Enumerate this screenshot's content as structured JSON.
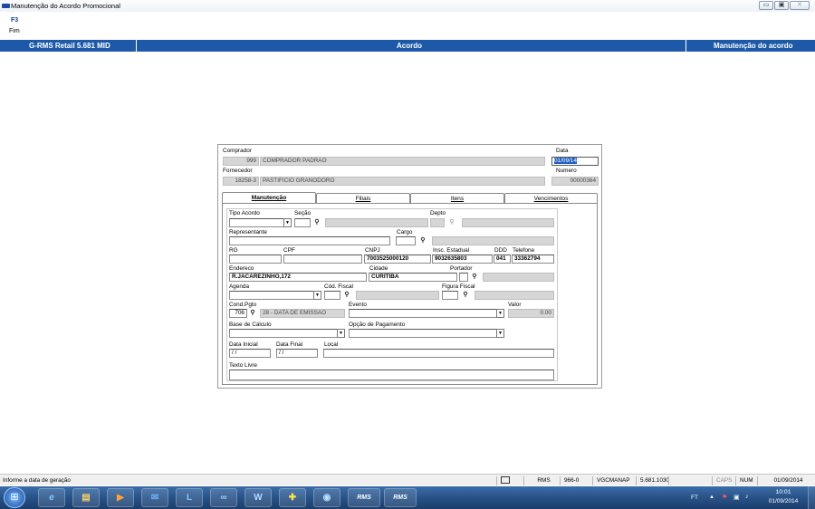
{
  "window": {
    "title": "Manutenção do Acordo Promocional",
    "min": "▭",
    "max": "▣",
    "close": "✕"
  },
  "fkey": {
    "key": "F3",
    "label": "Fim"
  },
  "header": {
    "left": "G-RMS Retail 5.681 MID",
    "center": "Acordo",
    "right": "Manutenção do acordo"
  },
  "top": {
    "comprador_label": "Comprador",
    "comprador_code": "999",
    "comprador_name": "COMPRADOR PADRAO",
    "data_label": "Data",
    "data_value": "01/09/14",
    "fornecedor_label": "Fornecedor",
    "fornecedor_code": "18258-3",
    "fornecedor_name": "PASTIFICIO GRANODORO",
    "numero_label": "Numero",
    "numero_value": "00000364"
  },
  "tabs": [
    {
      "label": "Manutenção",
      "active": true
    },
    {
      "label": "Filiais",
      "active": false
    },
    {
      "label": "Itens",
      "active": false
    },
    {
      "label": "Vencimentos",
      "active": false
    }
  ],
  "form": {
    "tipo_acordo_label": "Tipo Acordo",
    "tipo_acordo_value": "",
    "secao_label": "Seção",
    "depto_label": "Depto",
    "representante_label": "Representante",
    "cargo_label": "Cargo",
    "rg_label": "RG",
    "cpf_label": "CPF",
    "cnpj_label": "CNPJ",
    "cnpj_value": "7003525000120",
    "insc_label": "Insc. Estadual",
    "insc_value": "9032635803",
    "ddd_label": "DDD",
    "ddd_value": "041",
    "telefone_label": "Telefone",
    "telefone_value": "33362794",
    "endereco_label": "Endereco",
    "endereco_value": "R.JACAREZINHO,172",
    "cidade_label": "Cidade",
    "cidade_value": "CURITIBA",
    "portador_label": "Portador",
    "agenda_label": "Agenda",
    "cod_fiscal_label": "Cód. Fiscal",
    "figura_fiscal_label": "Figura Fiscal",
    "cond_pgto_label": "Cond.Pgto",
    "cond_pgto_code": "706",
    "cond_pgto_desc": "28 - DATA DE EMISSAO",
    "evento_label": "Evento",
    "valor_label": "Valor",
    "valor_value": "0.00",
    "base_calculo_label": "Base de Cálculo",
    "opcao_pagamento_label": "Opção de Pagamento",
    "data_inicial_label": "Data Inicial",
    "data_inicial_value": " / /",
    "data_final_label": "Data Final",
    "data_final_value": " / /",
    "local_label": "Local",
    "texto_livre_label": "Texto Livre"
  },
  "status": {
    "message": "Informe a data de geração",
    "app": "RMS",
    "code": "966-0",
    "user": "VGCMANAP",
    "version": "5.681.1030",
    "caps": "CAPS",
    "num": "NUM",
    "date": "01/09/2014"
  },
  "taskbar": {
    "apps": [
      "ie",
      "explorer",
      "media",
      "outlook",
      "lync",
      "app",
      "word",
      "game",
      "remote",
      "rms",
      "rms"
    ],
    "rms_label": "RMS",
    "lang": "FT",
    "time": "10:01",
    "date": "01/09/2014"
  },
  "colors": {
    "header_blue": "#1d59a8",
    "field_gray": "#d6d6d6",
    "taskbar": "#2a548a"
  }
}
